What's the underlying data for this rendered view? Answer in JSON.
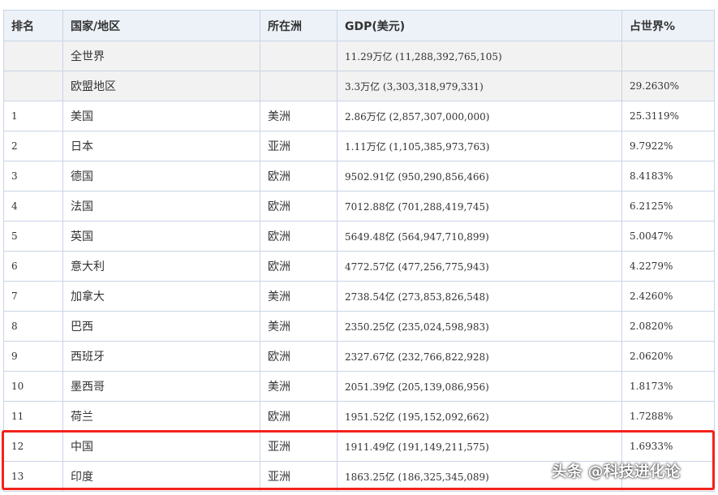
{
  "table": {
    "headers": [
      "排名",
      "国家/地区",
      "所在洲",
      "GDP(美元)",
      "占世界%"
    ],
    "aggregate_rows": [
      {
        "rank": "",
        "name": "全世界",
        "continent": "",
        "gdp": "11.29万亿 (11,288,392,765,105)",
        "share": ""
      },
      {
        "rank": "",
        "name": "欧盟地区",
        "continent": "",
        "gdp": "3.3万亿 (3,303,318,979,331)",
        "share": "29.2630%"
      }
    ],
    "rows": [
      {
        "rank": "1",
        "name": "美国",
        "continent": "美洲",
        "gdp": "2.86万亿 (2,857,307,000,000)",
        "share": "25.3119%"
      },
      {
        "rank": "2",
        "name": "日本",
        "continent": "亚洲",
        "gdp": "1.11万亿 (1,105,385,973,763)",
        "share": "9.7922%"
      },
      {
        "rank": "3",
        "name": "德国",
        "continent": "欧洲",
        "gdp": "9502.91亿 (950,290,856,466)",
        "share": "8.4183%"
      },
      {
        "rank": "4",
        "name": "法国",
        "continent": "欧洲",
        "gdp": "7012.88亿 (701,288,419,745)",
        "share": "6.2125%"
      },
      {
        "rank": "5",
        "name": "英国",
        "continent": "欧洲",
        "gdp": "5649.48亿 (564,947,710,899)",
        "share": "5.0047%"
      },
      {
        "rank": "6",
        "name": "意大利",
        "continent": "欧洲",
        "gdp": "4772.57亿 (477,256,775,943)",
        "share": "4.2279%"
      },
      {
        "rank": "7",
        "name": "加拿大",
        "continent": "美洲",
        "gdp": "2738.54亿 (273,853,826,548)",
        "share": "2.4260%"
      },
      {
        "rank": "8",
        "name": "巴西",
        "continent": "美洲",
        "gdp": "2350.25亿 (235,024,598,983)",
        "share": "2.0820%"
      },
      {
        "rank": "9",
        "name": "西班牙",
        "continent": "欧洲",
        "gdp": "2327.67亿 (232,766,822,928)",
        "share": "2.0620%"
      },
      {
        "rank": "10",
        "name": "墨西哥",
        "continent": "美洲",
        "gdp": "2051.39亿 (205,139,086,956)",
        "share": "1.8173%"
      },
      {
        "rank": "11",
        "name": "荷兰",
        "continent": "欧洲",
        "gdp": "1951.52亿 (195,152,092,662)",
        "share": "1.7288%"
      },
      {
        "rank": "12",
        "name": "中国",
        "continent": "亚洲",
        "gdp": "1911.49亿 (191,149,211,575)",
        "share": "1.6933%"
      },
      {
        "rank": "13",
        "name": "印度",
        "continent": "亚洲",
        "gdp": "1863.25亿 (186,325,345,089)",
        "share": ""
      }
    ]
  },
  "highlight_color": "#f2221c",
  "watermark": "头条 @科技进化论"
}
